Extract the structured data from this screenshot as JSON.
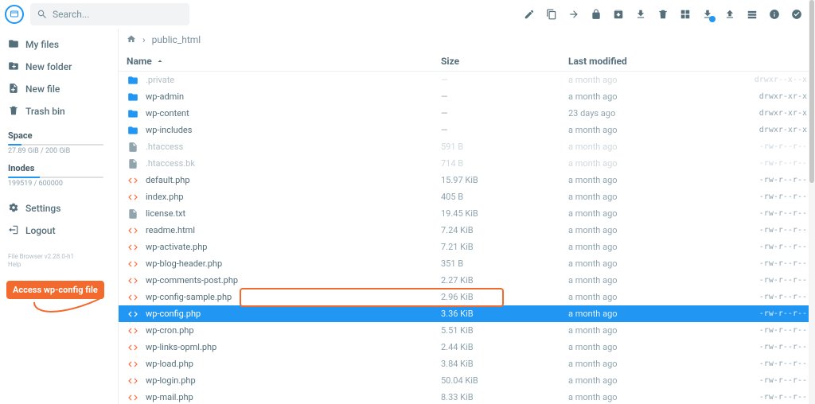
{
  "search": {
    "placeholder": "Search..."
  },
  "sidebar": {
    "items": [
      {
        "label": "My files",
        "icon": "folder"
      },
      {
        "label": "New folder",
        "icon": "folder-plus"
      },
      {
        "label": "New file",
        "icon": "file-plus"
      },
      {
        "label": "Trash bin",
        "icon": "trash"
      }
    ],
    "space": {
      "title": "Space",
      "used_pct": 14,
      "text": "27.89 GiB / 200 GiB"
    },
    "inodes": {
      "title": "Inodes",
      "used_pct": 33,
      "text": "199519 / 600000"
    },
    "bottom": [
      {
        "label": "Settings",
        "icon": "settings"
      },
      {
        "label": "Logout",
        "icon": "logout"
      }
    ],
    "footer": {
      "line1": "File Browser v2.28.0-h1",
      "line2": "Help"
    }
  },
  "breadcrumb": {
    "home": "home",
    "sep": "›",
    "folder": "public_html"
  },
  "columns": {
    "name": "Name",
    "size": "Size",
    "modified": "Last modified"
  },
  "files": [
    {
      "name": ".private",
      "type": "folder",
      "size": "—",
      "modified": "a month ago",
      "perm": "drwxr--x--x",
      "dim": true
    },
    {
      "name": "wp-admin",
      "type": "folder",
      "size": "—",
      "modified": "a month ago",
      "perm": "drwxr-xr-x"
    },
    {
      "name": "wp-content",
      "type": "folder",
      "size": "—",
      "modified": "23 days ago",
      "perm": "drwxr-xr-x"
    },
    {
      "name": "wp-includes",
      "type": "folder",
      "size": "—",
      "modified": "a month ago",
      "perm": "drwxr-xr-x"
    },
    {
      "name": ".htaccess",
      "type": "file",
      "size": "591 B",
      "modified": "a month ago",
      "perm": "-rw-r--r--",
      "dim": true
    },
    {
      "name": ".htaccess.bk",
      "type": "file",
      "size": "714 B",
      "modified": "a month ago",
      "perm": "-rw-r--r--",
      "dim": true
    },
    {
      "name": "default.php",
      "type": "code",
      "size": "15.97 KiB",
      "modified": "a month ago",
      "perm": "-rw-r--r--"
    },
    {
      "name": "index.php",
      "type": "code",
      "size": "405 B",
      "modified": "a month ago",
      "perm": "-rw-r--r--"
    },
    {
      "name": "license.txt",
      "type": "file",
      "size": "19.45 KiB",
      "modified": "a month ago",
      "perm": "-rw-r--r--"
    },
    {
      "name": "readme.html",
      "type": "code",
      "size": "7.24 KiB",
      "modified": "a month ago",
      "perm": "-rw-r--r--"
    },
    {
      "name": "wp-activate.php",
      "type": "code",
      "size": "7.21 KiB",
      "modified": "a month ago",
      "perm": "-rw-r--r--"
    },
    {
      "name": "wp-blog-header.php",
      "type": "code",
      "size": "351 B",
      "modified": "a month ago",
      "perm": "-rw-r--r--"
    },
    {
      "name": "wp-comments-post.php",
      "type": "code",
      "size": "2.27 KiB",
      "modified": "a month ago",
      "perm": "-rw-r--r--"
    },
    {
      "name": "wp-config-sample.php",
      "type": "code",
      "size": "2.96 KiB",
      "modified": "a month ago",
      "perm": "-rw-r--r--"
    },
    {
      "name": "wp-config.php",
      "type": "code",
      "size": "3.36 KiB",
      "modified": "a month ago",
      "perm": "-rw-r--r--",
      "selected": true
    },
    {
      "name": "wp-cron.php",
      "type": "code",
      "size": "5.51 KiB",
      "modified": "a month ago",
      "perm": "-rw-r--r--"
    },
    {
      "name": "wp-links-opml.php",
      "type": "code",
      "size": "2.44 KiB",
      "modified": "a month ago",
      "perm": "-rw-r--r--"
    },
    {
      "name": "wp-load.php",
      "type": "code",
      "size": "3.84 KiB",
      "modified": "a month ago",
      "perm": "-rw-r--r--"
    },
    {
      "name": "wp-login.php",
      "type": "code",
      "size": "50.04 KiB",
      "modified": "a month ago",
      "perm": "-rw-r--r--"
    },
    {
      "name": "wp-mail.php",
      "type": "code",
      "size": "8.33 KiB",
      "modified": "a month ago",
      "perm": "-rw-r--r--"
    }
  ],
  "toolbar": [
    "edit",
    "copy",
    "move",
    "lock",
    "archive",
    "download",
    "delete",
    "grid",
    "download-queue",
    "upload",
    "bulk",
    "info",
    "select-all"
  ],
  "annotation": {
    "text": "Access wp-config file"
  }
}
